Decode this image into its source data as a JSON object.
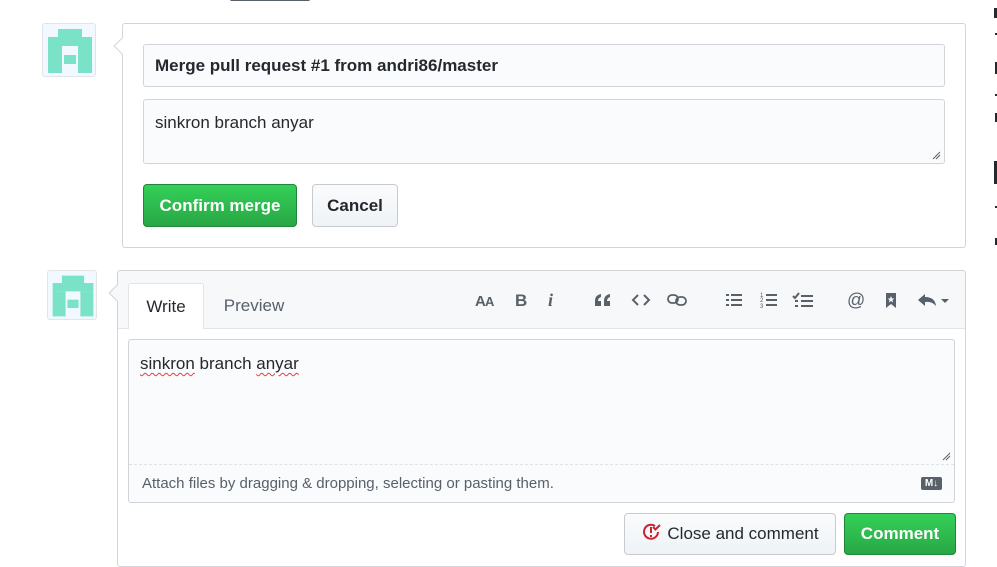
{
  "merge_box": {
    "commit_title": "Merge pull request #1 from andri86/master",
    "commit_message": "sinkron branch anyar",
    "confirm_label": "Confirm merge",
    "cancel_label": "Cancel"
  },
  "comment_box": {
    "tabs": [
      {
        "label": "Write",
        "active": true
      },
      {
        "label": "Preview",
        "active": false
      }
    ],
    "toolbar": [
      "text-size-icon",
      "bold-icon",
      "italic-icon",
      "quote-icon",
      "code-icon",
      "link-icon",
      "bulleted-list-icon",
      "numbered-list-icon",
      "task-list-icon",
      "mention-icon",
      "bookmark-icon",
      "reply-icon"
    ],
    "text_words": [
      "sinkron",
      "branch",
      "anyar"
    ],
    "attach_hint": "Attach files by dragging & dropping, selecting or pasting them.",
    "markdown_badge": "M↓",
    "close_label": "Close and comment",
    "comment_label": "Comment"
  },
  "colors": {
    "avatar": "#79e2c7",
    "green": "#28a745",
    "close_icon_red": "#cb2431"
  }
}
